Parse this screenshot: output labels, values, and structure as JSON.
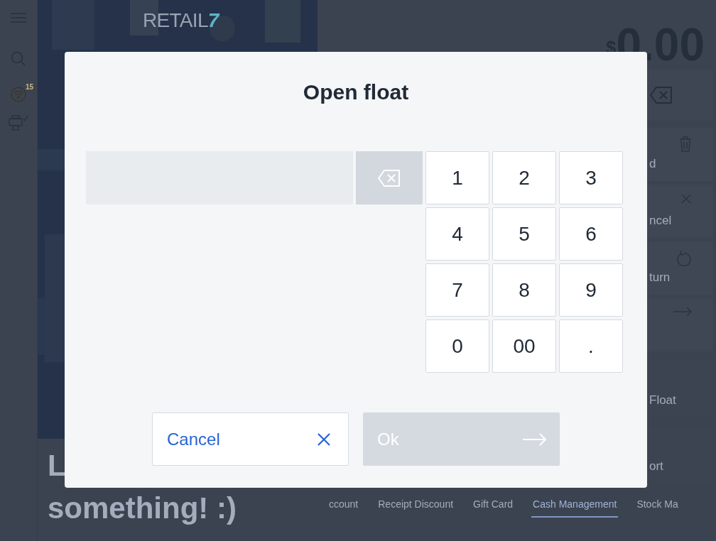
{
  "sidebar": {
    "badge": "15"
  },
  "logo": {
    "text": "RETAIL",
    "mark": "7"
  },
  "headline": [
    "L",
    "something! :)"
  ],
  "total": {
    "currency": "$",
    "amount": "0.00"
  },
  "actions": [
    {
      "kind": "trash",
      "label": "d"
    },
    {
      "kind": "cancel",
      "label": "ncel"
    },
    {
      "kind": "return",
      "label": "turn"
    },
    {
      "kind": "next"
    },
    {
      "kind": "text",
      "label": "Float"
    },
    {
      "kind": "text",
      "label": "ort"
    }
  ],
  "tabs": [
    {
      "label": "ccount",
      "selected": false
    },
    {
      "label": "Receipt Discount",
      "selected": false
    },
    {
      "label": "Gift Card",
      "selected": false
    },
    {
      "label": "Cash Management",
      "selected": true
    },
    {
      "label": "Stock Ma",
      "selected": false
    }
  ],
  "dialog": {
    "title": "Open float",
    "keys": [
      "1",
      "2",
      "3",
      "4",
      "5",
      "6",
      "7",
      "8",
      "9",
      "0",
      "00",
      "."
    ],
    "cancel": {
      "label": "Cancel"
    },
    "ok": {
      "label": "Ok",
      "disabled": true
    }
  }
}
